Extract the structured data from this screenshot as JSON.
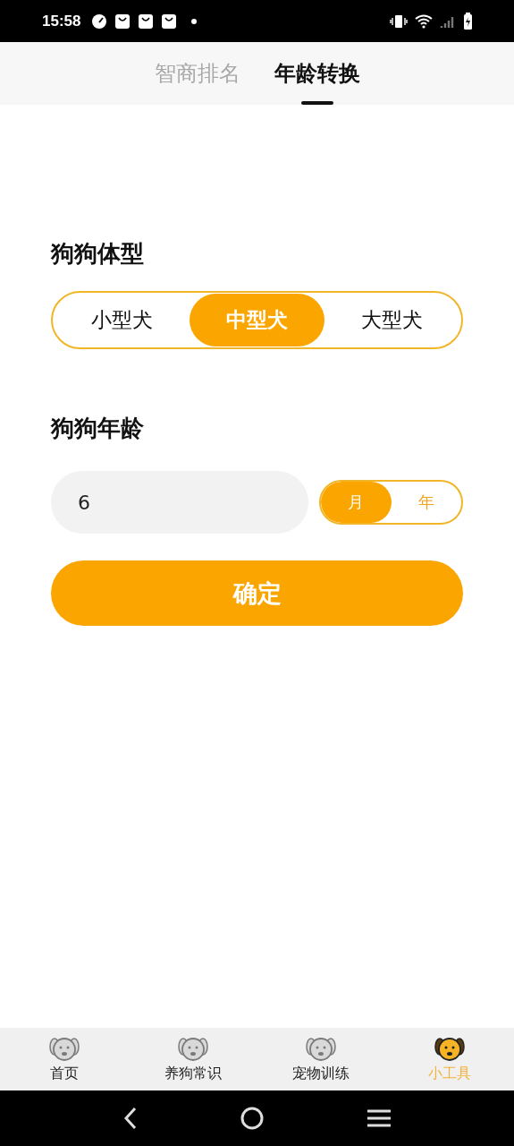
{
  "status_bar": {
    "time": "15:58"
  },
  "tabs": [
    {
      "label": "智商排名",
      "selected": false
    },
    {
      "label": "年龄转换",
      "selected": true
    }
  ],
  "size_section": {
    "title": "狗狗体型",
    "options": [
      {
        "label": "小型犬",
        "selected": false
      },
      {
        "label": "中型犬",
        "selected": true
      },
      {
        "label": "大型犬",
        "selected": false
      }
    ]
  },
  "age_section": {
    "title": "狗狗年龄",
    "value": "6",
    "units": [
      {
        "label": "月",
        "selected": true
      },
      {
        "label": "年",
        "selected": false
      }
    ]
  },
  "confirm_button": "确定",
  "bottom_nav": [
    {
      "label": "首页",
      "selected": false
    },
    {
      "label": "养狗常识",
      "selected": false
    },
    {
      "label": "宠物训练",
      "selected": false
    },
    {
      "label": "小工具",
      "selected": true
    }
  ]
}
